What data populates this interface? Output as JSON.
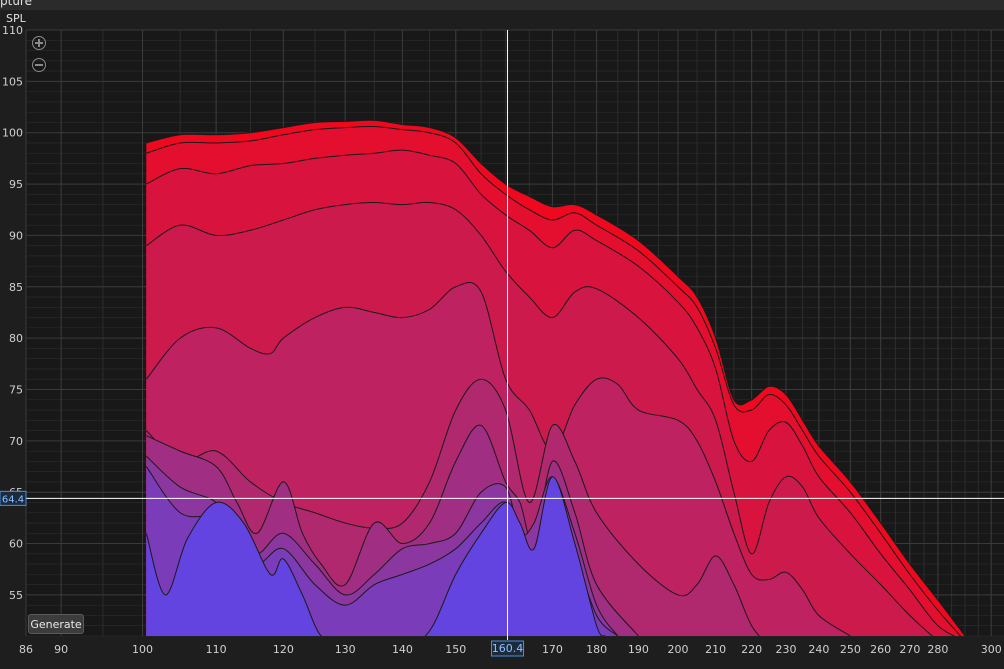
{
  "window": {
    "title_fragment": "pture"
  },
  "controls": {
    "generate_label": "Generate"
  },
  "icons": {
    "zoom_in": "zoom-in-icon",
    "zoom_out": "zoom-out-icon"
  },
  "colors": {
    "background": "#1e1e1e",
    "grid_major": "#3a3a3a",
    "grid_minor": "#2c2c2c",
    "cursor": "#ffffff",
    "cursor_label": "#4a90e2",
    "outline": "#1a1a1a"
  },
  "chart_data": {
    "type": "area",
    "ylabel": "SPL",
    "xscale": "log",
    "xlim": [
      86,
      305
    ],
    "ylim": [
      51,
      110
    ],
    "yticks": [
      55,
      60,
      65,
      70,
      75,
      80,
      85,
      90,
      95,
      100,
      105,
      110
    ],
    "xticks": [
      86,
      90,
      100,
      110,
      120,
      130,
      140,
      150,
      170,
      180,
      190,
      200,
      210,
      220,
      230,
      240,
      250,
      260,
      270,
      280,
      300
    ],
    "grid": true,
    "cursor": {
      "x": 160.4,
      "y": 64.4,
      "x_label": "160.4",
      "y_label": "64.4"
    },
    "series": [
      {
        "color": "#f0081e",
        "points": [
          [
            100.5,
            99
          ],
          [
            105,
            99.8
          ],
          [
            110,
            99.8
          ],
          [
            115,
            100
          ],
          [
            120,
            100.5
          ],
          [
            125,
            101
          ],
          [
            130,
            101.1
          ],
          [
            135,
            101.2
          ],
          [
            140,
            100.8
          ],
          [
            145,
            100.5
          ],
          [
            150,
            99.5
          ],
          [
            155,
            97
          ],
          [
            160,
            95
          ],
          [
            165,
            93.8
          ],
          [
            170,
            92.8
          ],
          [
            175,
            93
          ],
          [
            180,
            92
          ],
          [
            190,
            89.5
          ],
          [
            200,
            86
          ],
          [
            205,
            84
          ],
          [
            210,
            80
          ],
          [
            215,
            74
          ],
          [
            220,
            74
          ],
          [
            225,
            75.3
          ],
          [
            230,
            74.5
          ],
          [
            235,
            72
          ],
          [
            240,
            69.5
          ],
          [
            250,
            66
          ],
          [
            260,
            62
          ],
          [
            270,
            58
          ],
          [
            280,
            54.5
          ],
          [
            290,
            51
          ]
        ]
      },
      {
        "color": "#e40e2e",
        "points": [
          [
            100.5,
            98
          ],
          [
            105,
            99
          ],
          [
            110,
            99
          ],
          [
            115,
            99.2
          ],
          [
            120,
            99.8
          ],
          [
            125,
            100.3
          ],
          [
            130,
            100.5
          ],
          [
            135,
            100.6
          ],
          [
            140,
            100.3
          ],
          [
            145,
            100
          ],
          [
            150,
            99
          ],
          [
            155,
            96
          ],
          [
            160,
            94
          ],
          [
            165,
            92.5
          ],
          [
            170,
            91.5
          ],
          [
            175,
            92.2
          ],
          [
            180,
            91
          ],
          [
            190,
            88.5
          ],
          [
            200,
            85
          ],
          [
            205,
            83
          ],
          [
            210,
            79
          ],
          [
            215,
            73.5
          ],
          [
            220,
            73
          ],
          [
            225,
            74.5
          ],
          [
            230,
            73.5
          ],
          [
            235,
            71
          ],
          [
            240,
            68.5
          ],
          [
            250,
            65
          ],
          [
            260,
            61
          ],
          [
            270,
            57
          ],
          [
            280,
            53.5
          ],
          [
            290,
            50.5
          ]
        ]
      },
      {
        "color": "#d8143e",
        "points": [
          [
            100.5,
            95
          ],
          [
            105,
            96.5
          ],
          [
            110,
            96
          ],
          [
            115,
            96.8
          ],
          [
            120,
            97
          ],
          [
            125,
            97.5
          ],
          [
            130,
            97.8
          ],
          [
            135,
            98
          ],
          [
            140,
            98.3
          ],
          [
            145,
            97.8
          ],
          [
            150,
            97
          ],
          [
            155,
            94
          ],
          [
            160,
            92
          ],
          [
            165,
            90.5
          ],
          [
            170,
            88.8
          ],
          [
            175,
            90.5
          ],
          [
            180,
            89.5
          ],
          [
            190,
            87
          ],
          [
            200,
            83.5
          ],
          [
            205,
            81
          ],
          [
            210,
            77
          ],
          [
            215,
            70
          ],
          [
            220,
            68
          ],
          [
            225,
            71
          ],
          [
            230,
            71.8
          ],
          [
            235,
            69.5
          ],
          [
            240,
            66.5
          ],
          [
            250,
            63
          ],
          [
            260,
            59
          ],
          [
            270,
            55.5
          ],
          [
            280,
            52
          ],
          [
            290,
            50.5
          ]
        ]
      },
      {
        "color": "#cc1a4c",
        "points": [
          [
            100.5,
            89
          ],
          [
            105,
            91
          ],
          [
            110,
            90
          ],
          [
            115,
            90.5
          ],
          [
            120,
            91.5
          ],
          [
            125,
            92.5
          ],
          [
            130,
            93
          ],
          [
            135,
            93.2
          ],
          [
            140,
            93
          ],
          [
            145,
            93.2
          ],
          [
            150,
            92.5
          ],
          [
            155,
            90
          ],
          [
            160,
            86.5
          ],
          [
            165,
            84
          ],
          [
            170,
            82
          ],
          [
            175,
            84.5
          ],
          [
            180,
            84.8
          ],
          [
            190,
            82
          ],
          [
            200,
            78
          ],
          [
            205,
            75
          ],
          [
            210,
            72
          ],
          [
            215,
            65
          ],
          [
            220,
            59
          ],
          [
            225,
            64
          ],
          [
            230,
            66.5
          ],
          [
            235,
            65.5
          ],
          [
            240,
            62.5
          ],
          [
            250,
            59
          ],
          [
            260,
            56
          ],
          [
            270,
            53
          ],
          [
            280,
            50.5
          ]
        ]
      },
      {
        "color": "#be2260",
        "points": [
          [
            100.5,
            76
          ],
          [
            105,
            80
          ],
          [
            110,
            81
          ],
          [
            115,
            79
          ],
          [
            118,
            78.5
          ],
          [
            120,
            80
          ],
          [
            125,
            82
          ],
          [
            130,
            83
          ],
          [
            135,
            82.5
          ],
          [
            140,
            82
          ],
          [
            145,
            82.8
          ],
          [
            150,
            85
          ],
          [
            155,
            84.5
          ],
          [
            160,
            76
          ],
          [
            165,
            73
          ],
          [
            170,
            69
          ],
          [
            175,
            73.5
          ],
          [
            180,
            76
          ],
          [
            185,
            75.5
          ],
          [
            190,
            73
          ],
          [
            200,
            72
          ],
          [
            205,
            70
          ],
          [
            210,
            66
          ],
          [
            215,
            61
          ],
          [
            220,
            57
          ],
          [
            225,
            56.5
          ],
          [
            230,
            57.2
          ],
          [
            235,
            55.5
          ],
          [
            240,
            53
          ],
          [
            250,
            51
          ]
        ]
      },
      {
        "color": "#b0286e",
        "points": [
          [
            100.5,
            71
          ],
          [
            105,
            68
          ],
          [
            110,
            69
          ],
          [
            115,
            66
          ],
          [
            120,
            64
          ],
          [
            125,
            63
          ],
          [
            130,
            62
          ],
          [
            135,
            61.5
          ],
          [
            140,
            62
          ],
          [
            145,
            66
          ],
          [
            150,
            73
          ],
          [
            155,
            76
          ],
          [
            160,
            73
          ],
          [
            165,
            64
          ],
          [
            170,
            71.5
          ],
          [
            175,
            68
          ],
          [
            180,
            63
          ],
          [
            190,
            58
          ],
          [
            200,
            55
          ],
          [
            205,
            56
          ],
          [
            210,
            58.8
          ],
          [
            215,
            56
          ],
          [
            220,
            52
          ],
          [
            225,
            50
          ]
        ]
      },
      {
        "color": "#a02e82",
        "points": [
          [
            100.5,
            70.5
          ],
          [
            105,
            69
          ],
          [
            110,
            67.5
          ],
          [
            113,
            64
          ],
          [
            116,
            61
          ],
          [
            120,
            66
          ],
          [
            123,
            61
          ],
          [
            126,
            58
          ],
          [
            130,
            56
          ],
          [
            135,
            62
          ],
          [
            140,
            60
          ],
          [
            145,
            62
          ],
          [
            150,
            68
          ],
          [
            155,
            71.5
          ],
          [
            160,
            66
          ],
          [
            163,
            64
          ],
          [
            166,
            60
          ],
          [
            170,
            68
          ],
          [
            175,
            63
          ],
          [
            180,
            56
          ],
          [
            190,
            51
          ]
        ]
      },
      {
        "color": "#8c36a0",
        "points": [
          [
            100.5,
            68.5
          ],
          [
            105,
            65.5
          ],
          [
            110,
            64
          ],
          [
            113,
            61
          ],
          [
            116,
            59
          ],
          [
            120,
            61
          ],
          [
            125,
            58
          ],
          [
            130,
            55
          ],
          [
            135,
            57
          ],
          [
            140,
            59.5
          ],
          [
            145,
            60
          ],
          [
            150,
            61
          ],
          [
            155,
            65
          ],
          [
            160,
            65.5
          ],
          [
            163,
            61
          ],
          [
            166,
            62
          ],
          [
            170,
            66.5
          ],
          [
            175,
            61
          ],
          [
            180,
            54
          ],
          [
            185,
            51
          ]
        ]
      },
      {
        "color": "#7a3cb8",
        "points": [
          [
            100.5,
            67.5
          ],
          [
            105,
            63
          ],
          [
            110,
            62.5
          ],
          [
            113,
            60
          ],
          [
            116,
            58
          ],
          [
            120,
            59.5
          ],
          [
            125,
            56
          ],
          [
            130,
            54
          ],
          [
            135,
            56
          ],
          [
            140,
            57
          ],
          [
            145,
            58
          ],
          [
            150,
            59.5
          ],
          [
            155,
            62
          ],
          [
            160,
            64
          ],
          [
            163,
            60
          ],
          [
            166,
            59.5
          ],
          [
            170,
            65
          ],
          [
            175,
            59
          ],
          [
            180,
            53
          ],
          [
            185,
            51
          ]
        ]
      },
      {
        "color": "#6344e0",
        "points": [
          [
            100.5,
            61
          ],
          [
            103,
            55
          ],
          [
            106,
            60.5
          ],
          [
            110,
            64
          ],
          [
            114,
            62
          ],
          [
            118,
            57
          ],
          [
            120,
            58.5
          ],
          [
            123,
            55
          ],
          [
            126,
            51
          ],
          [
            130,
            50
          ],
          [
            140,
            50
          ],
          [
            145,
            51.5
          ],
          [
            150,
            57
          ],
          [
            155,
            61
          ],
          [
            160,
            64
          ],
          [
            163,
            62
          ],
          [
            166,
            59.5
          ],
          [
            170,
            66.5
          ],
          [
            175,
            60
          ],
          [
            180,
            52
          ],
          [
            182,
            51
          ]
        ]
      }
    ]
  }
}
